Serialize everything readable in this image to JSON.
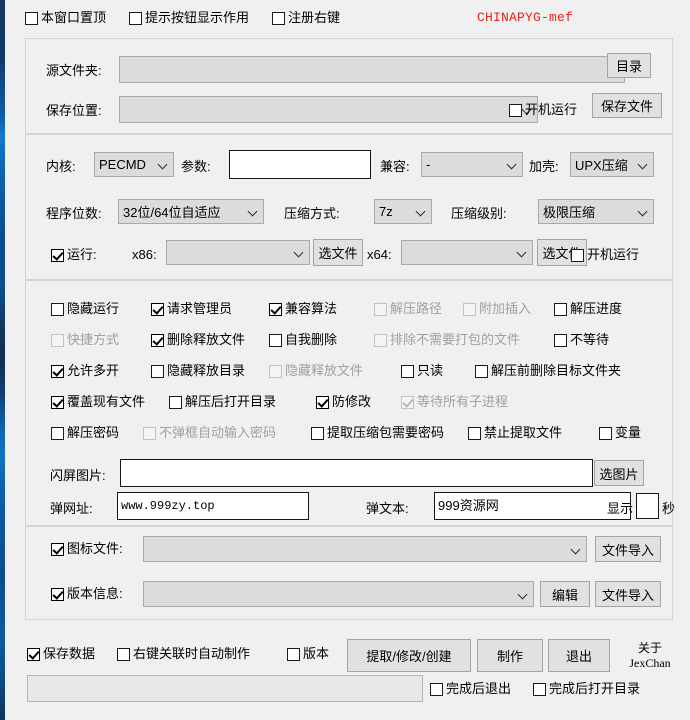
{
  "window": {
    "brand_watermark": "CHINAPYG-mef",
    "accent_color": "#1273c2",
    "brand_color": "#e8221f"
  },
  "topbar": {
    "checkboxes": [
      {
        "label": "本窗口置顶",
        "checked": false,
        "enabled": true
      },
      {
        "label": "提示按钮显示作用",
        "checked": false,
        "enabled": true
      },
      {
        "label": "注册右键",
        "checked": false,
        "enabled": true
      }
    ]
  },
  "group_paths": {
    "source_label": "源文件夹:",
    "source_value": "",
    "browse_dir_button": "目录",
    "save_label": "保存位置:",
    "save_value": "",
    "startup_run_label": "开机运行",
    "startup_run_checked": false,
    "save_file_button": "保存文件"
  },
  "group_engine": {
    "kernel_label": "内核:",
    "kernel_value": "PECMD",
    "params_label": "参数:",
    "params_value": "",
    "compat_label": "兼容:",
    "compat_value": "-",
    "shell_label": "加壳:",
    "shell_value": "UPX压缩",
    "bits_label": "程序位数:",
    "bits_value": "32位/64位自适应",
    "compress_mode_label": "压缩方式:",
    "compress_mode_value": "7z",
    "compress_level_label": "压缩级别:",
    "compress_level_value": "极限压缩",
    "run_checkbox_label": "运行:",
    "run_checkbox_checked": true,
    "x86_label": "x86:",
    "x86_value": "",
    "x86_pick_button": "选文件",
    "x64_label": "x64:",
    "x64_value": "",
    "x64_pick_button": "选文件",
    "startup_run_label": "开机运行",
    "startup_run_checked": false
  },
  "group_options": {
    "rows": [
      [
        {
          "label": "隐藏运行",
          "checked": false,
          "enabled": true
        },
        {
          "label": "请求管理员",
          "checked": true,
          "enabled": true
        },
        {
          "label": "兼容算法",
          "checked": true,
          "enabled": true
        },
        {
          "label": "解压路径",
          "checked": false,
          "enabled": false
        },
        {
          "label": "附加插入",
          "checked": false,
          "enabled": false
        },
        {
          "label": "解压进度",
          "checked": false,
          "enabled": true
        }
      ],
      [
        {
          "label": "快捷方式",
          "checked": false,
          "enabled": false
        },
        {
          "label": "删除释放文件",
          "checked": true,
          "enabled": true
        },
        {
          "label": "自我删除",
          "checked": false,
          "enabled": true
        },
        {
          "label": "排除不需要打包的文件",
          "checked": false,
          "enabled": false
        },
        {
          "label": "不等待",
          "checked": false,
          "enabled": true
        }
      ],
      [
        {
          "label": "允许多开",
          "checked": true,
          "enabled": true
        },
        {
          "label": "隐藏释放目录",
          "checked": false,
          "enabled": true
        },
        {
          "label": "隐藏释放文件",
          "checked": false,
          "enabled": false
        },
        {
          "label": "只读",
          "checked": false,
          "enabled": true
        },
        {
          "label": "解压前删除目标文件夹",
          "checked": false,
          "enabled": true
        }
      ],
      [
        {
          "label": "覆盖现有文件",
          "checked": true,
          "enabled": true
        },
        {
          "label": "解压后打开目录",
          "checked": false,
          "enabled": true
        },
        {
          "label": "防修改",
          "checked": true,
          "enabled": true
        },
        {
          "label": "等待所有子进程",
          "checked": true,
          "enabled": false
        }
      ],
      [
        {
          "label": "解压密码",
          "checked": false,
          "enabled": true
        },
        {
          "label": "不弹框自动输入密码",
          "checked": false,
          "enabled": false
        },
        {
          "label": "提取压缩包需要密码",
          "checked": false,
          "enabled": true
        },
        {
          "label": "禁止提取文件",
          "checked": false,
          "enabled": true
        },
        {
          "label": "变量",
          "checked": false,
          "enabled": true
        }
      ]
    ],
    "splash_label": "闪屏图片:",
    "splash_value": "",
    "splash_pick_button": "选图片",
    "url_label": "弹网址:",
    "url_value": "www.999zy.top",
    "text_label": "弹文本:",
    "text_value": "999资源网",
    "show_label": "显示",
    "seconds_value": "",
    "seconds_unit": "秒"
  },
  "group_resources": {
    "icon_label": "图标文件:",
    "icon_checked": true,
    "icon_value": "",
    "icon_import_button": "文件导入",
    "version_label": "版本信息:",
    "version_checked": true,
    "version_value": "",
    "version_edit_button": "编辑",
    "version_import_button": "文件导入"
  },
  "footer": {
    "save_data_label": "保存数据",
    "save_data_checked": true,
    "auto_build_label": "右键关联时自动制作",
    "auto_build_checked": false,
    "version_label": "版本",
    "version_checked": false,
    "extract_modify_create_button": "提取/修改/创建",
    "build_button": "制作",
    "exit_button": "退出",
    "about_line1": "关于",
    "about_line2": "JexChan",
    "progress_value": "",
    "exit_after_done_label": "完成后退出",
    "exit_after_done_checked": false,
    "open_dir_after_done_label": "完成后打开目录",
    "open_dir_after_done_checked": false
  }
}
